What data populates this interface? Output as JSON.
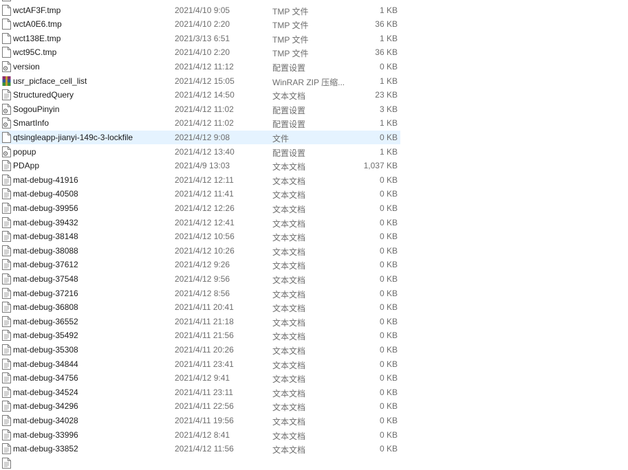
{
  "files": [
    {
      "name": "",
      "date": "",
      "type": "",
      "size": "",
      "icon": "text-file-icon"
    },
    {
      "name": "wctAF3F.tmp",
      "date": "2021/4/10 9:05",
      "type": "TMP 文件",
      "size": "1 KB",
      "icon": "blank-file-icon"
    },
    {
      "name": "wctA0E6.tmp",
      "date": "2021/4/10 2:20",
      "type": "TMP 文件",
      "size": "36 KB",
      "icon": "blank-file-icon"
    },
    {
      "name": "wct138E.tmp",
      "date": "2021/3/13 6:51",
      "type": "TMP 文件",
      "size": "1 KB",
      "icon": "blank-file-icon"
    },
    {
      "name": "wct95C.tmp",
      "date": "2021/4/10 2:20",
      "type": "TMP 文件",
      "size": "36 KB",
      "icon": "blank-file-icon"
    },
    {
      "name": "version",
      "date": "2021/4/12 11:12",
      "type": "配置设置",
      "size": "0 KB",
      "icon": "settings-file-icon"
    },
    {
      "name": "usr_picface_cell_list",
      "date": "2021/4/12 15:05",
      "type": "WinRAR ZIP 压缩...",
      "size": "1 KB",
      "icon": "winrar-archive-icon"
    },
    {
      "name": "StructuredQuery",
      "date": "2021/4/12 14:50",
      "type": "文本文档",
      "size": "23 KB",
      "icon": "text-file-icon"
    },
    {
      "name": "SogouPinyin",
      "date": "2021/4/12 11:02",
      "type": "配置设置",
      "size": "3 KB",
      "icon": "settings-file-icon"
    },
    {
      "name": "SmartInfo",
      "date": "2021/4/12 11:02",
      "type": "配置设置",
      "size": "1 KB",
      "icon": "settings-file-icon"
    },
    {
      "name": "qtsingleapp-jianyi-149c-3-lockfile",
      "date": "2021/4/12 9:08",
      "type": "文件",
      "size": "0 KB",
      "icon": "blank-file-icon",
      "selected": true
    },
    {
      "name": "popup",
      "date": "2021/4/12 13:40",
      "type": "配置设置",
      "size": "1 KB",
      "icon": "settings-file-icon"
    },
    {
      "name": "PDApp",
      "date": "2021/4/9 13:03",
      "type": "文本文档",
      "size": "1,037 KB",
      "icon": "text-file-icon"
    },
    {
      "name": "mat-debug-41916",
      "date": "2021/4/12 12:11",
      "type": "文本文档",
      "size": "0 KB",
      "icon": "text-file-icon"
    },
    {
      "name": "mat-debug-40508",
      "date": "2021/4/12 11:41",
      "type": "文本文档",
      "size": "0 KB",
      "icon": "text-file-icon"
    },
    {
      "name": "mat-debug-39956",
      "date": "2021/4/12 12:26",
      "type": "文本文档",
      "size": "0 KB",
      "icon": "text-file-icon"
    },
    {
      "name": "mat-debug-39432",
      "date": "2021/4/12 12:41",
      "type": "文本文档",
      "size": "0 KB",
      "icon": "text-file-icon"
    },
    {
      "name": "mat-debug-38148",
      "date": "2021/4/12 10:56",
      "type": "文本文档",
      "size": "0 KB",
      "icon": "text-file-icon"
    },
    {
      "name": "mat-debug-38088",
      "date": "2021/4/12 10:26",
      "type": "文本文档",
      "size": "0 KB",
      "icon": "text-file-icon"
    },
    {
      "name": "mat-debug-37612",
      "date": "2021/4/12 9:26",
      "type": "文本文档",
      "size": "0 KB",
      "icon": "text-file-icon"
    },
    {
      "name": "mat-debug-37548",
      "date": "2021/4/12 9:56",
      "type": "文本文档",
      "size": "0 KB",
      "icon": "text-file-icon"
    },
    {
      "name": "mat-debug-37216",
      "date": "2021/4/12 8:56",
      "type": "文本文档",
      "size": "0 KB",
      "icon": "text-file-icon"
    },
    {
      "name": "mat-debug-36808",
      "date": "2021/4/11 20:41",
      "type": "文本文档",
      "size": "0 KB",
      "icon": "text-file-icon"
    },
    {
      "name": "mat-debug-36552",
      "date": "2021/4/11 21:18",
      "type": "文本文档",
      "size": "0 KB",
      "icon": "text-file-icon"
    },
    {
      "name": "mat-debug-35492",
      "date": "2021/4/11 21:56",
      "type": "文本文档",
      "size": "0 KB",
      "icon": "text-file-icon"
    },
    {
      "name": "mat-debug-35308",
      "date": "2021/4/11 20:26",
      "type": "文本文档",
      "size": "0 KB",
      "icon": "text-file-icon"
    },
    {
      "name": "mat-debug-34844",
      "date": "2021/4/11 23:41",
      "type": "文本文档",
      "size": "0 KB",
      "icon": "text-file-icon"
    },
    {
      "name": "mat-debug-34756",
      "date": "2021/4/12 9:41",
      "type": "文本文档",
      "size": "0 KB",
      "icon": "text-file-icon"
    },
    {
      "name": "mat-debug-34524",
      "date": "2021/4/11 23:11",
      "type": "文本文档",
      "size": "0 KB",
      "icon": "text-file-icon"
    },
    {
      "name": "mat-debug-34296",
      "date": "2021/4/11 22:56",
      "type": "文本文档",
      "size": "0 KB",
      "icon": "text-file-icon"
    },
    {
      "name": "mat-debug-34028",
      "date": "2021/4/11 19:56",
      "type": "文本文档",
      "size": "0 KB",
      "icon": "text-file-icon"
    },
    {
      "name": "mat-debug-33996",
      "date": "2021/4/12 8:41",
      "type": "文本文档",
      "size": "0 KB",
      "icon": "text-file-icon"
    },
    {
      "name": "mat-debug-33852",
      "date": "2021/4/12 11:56",
      "type": "文本文档",
      "size": "0 KB",
      "icon": "text-file-icon"
    },
    {
      "name": "",
      "date": "",
      "type": "",
      "size": "",
      "icon": "text-file-icon"
    }
  ],
  "colors": {
    "selected_row": "#e5f3ff",
    "secondary_text": "#6d6d6d"
  }
}
